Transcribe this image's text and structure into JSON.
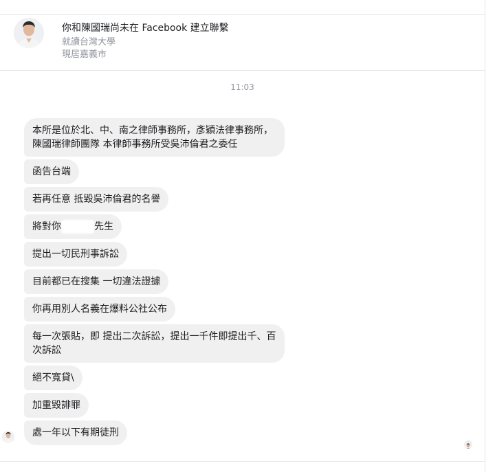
{
  "header": {
    "name_line": "你和陳國瑞尚未在 Facebook 建立聯繫",
    "education": "就讀台灣大學",
    "location": "現居嘉義市"
  },
  "timestamp": "11:03",
  "messages": [
    {
      "text": "本所是位於北、中、南之律師事務所，彥穎法律事務所，陳國瑞律師團隊 本律師事務所受吳沛倫君之委任"
    },
    {
      "text": "函告台端"
    },
    {
      "text": "若再任意 抵毀吳沛倫君的名譽"
    },
    {
      "text_before": "將對你",
      "text_after": "先生",
      "redacted": true
    },
    {
      "text": "提出一切民刑事訴訟"
    },
    {
      "text": "目前都已在搜集 一切違法證據"
    },
    {
      "text": "你再用別人名義在爆料公社公布"
    },
    {
      "text": "每一次張貼，即 提出二次訴訟，提出一千件即提出千、百次訴訟"
    },
    {
      "text": "絕不寬貸\\"
    },
    {
      "text": "加重毀誹罪"
    },
    {
      "text": "處一年以下有期徒刑"
    }
  ],
  "icons": {
    "header_avatar": "profile-photo-icon",
    "sender_avatar": "sender-avatar-icon",
    "read_receipt": "seen-avatar-icon"
  }
}
